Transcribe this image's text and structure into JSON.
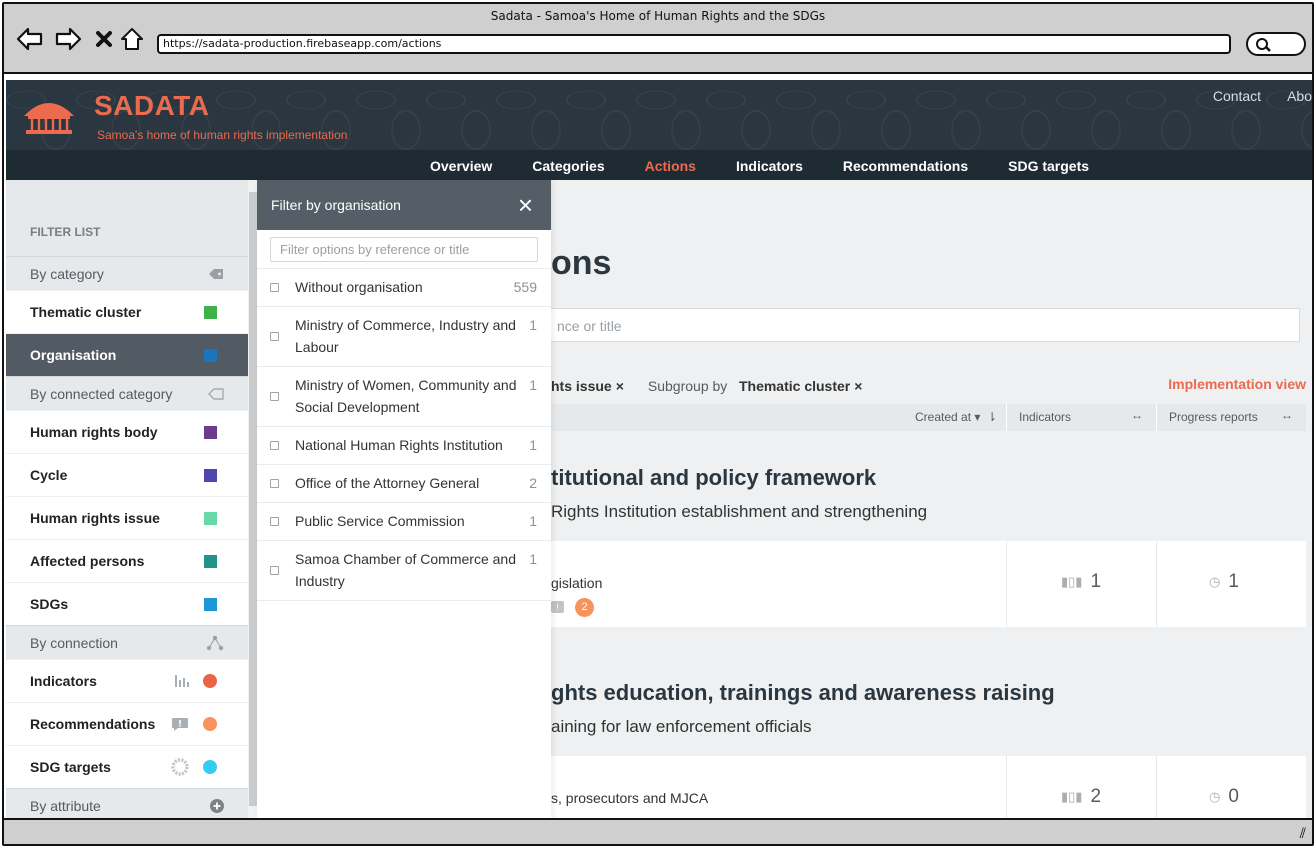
{
  "window": {
    "title": "Sadata - Samoa's Home of Human Rights and the SDGs",
    "url": "https://sadata-production.firebaseapp.com/actions"
  },
  "header": {
    "brand": "SADATA",
    "tagline": "Samoa's home of human rights implementation",
    "top_links": [
      "Contact",
      "Abo"
    ],
    "nav": [
      {
        "label": "Overview",
        "active": false
      },
      {
        "label": "Categories",
        "active": false
      },
      {
        "label": "Actions",
        "active": true
      },
      {
        "label": "Indicators",
        "active": false
      },
      {
        "label": "Recommendations",
        "active": false
      },
      {
        "label": "SDG targets",
        "active": false
      }
    ]
  },
  "sidebar": {
    "heading": "FILTER LIST",
    "group_category": "By category",
    "group_connected": "By connected category",
    "group_connection": "By connection",
    "group_attribute": "By attribute",
    "category_items": [
      {
        "label": "Thematic cluster",
        "color": "#3db249"
      },
      {
        "label": "Organisation",
        "color": "#1b75bb",
        "active": true
      }
    ],
    "connected_items": [
      {
        "label": "Human rights body",
        "color": "#6d3b8e"
      },
      {
        "label": "Cycle",
        "color": "#4f46b0"
      },
      {
        "label": "Human rights issue",
        "color": "#67d9a8"
      },
      {
        "label": "Affected persons",
        "color": "#21938a"
      },
      {
        "label": "SDGs",
        "color": "#1e97d6"
      }
    ],
    "connection_items": [
      {
        "label": "Indicators",
        "color": "#ea6447",
        "icon": "indicator-bars-icon"
      },
      {
        "label": "Recommendations",
        "color": "#f7935c",
        "icon": "comment-icon"
      },
      {
        "label": "SDG targets",
        "color": "#33ccf2",
        "icon": "sdg-wheel-icon"
      }
    ]
  },
  "filter_panel": {
    "title": "Filter by organisation",
    "close_icon": "×",
    "search_placeholder": "Filter options by reference or title",
    "options": [
      {
        "label": "Without organisation",
        "count": "559"
      },
      {
        "label": "Ministry of Commerce, Industry and Labour",
        "count": "1"
      },
      {
        "label": "Ministry of Women, Community and Social Development",
        "count": "1"
      },
      {
        "label": "National Human Rights Institution",
        "count": "1"
      },
      {
        "label": "Office of the Attorney General",
        "count": "2"
      },
      {
        "label": "Public Service Commission",
        "count": "1"
      },
      {
        "label": "Samoa Chamber of Commerce and Industry",
        "count": "1"
      }
    ]
  },
  "main": {
    "title_fragment": "ons",
    "search_fragment": "nce or title",
    "group_chip": "hts issue",
    "subgroup_label": "Subgroup by",
    "subgroup_value": "Thematic cluster",
    "implementation_link": "Implementation view",
    "columns": {
      "created": "Created at",
      "indicators": "Indicators",
      "progress": "Progress reports"
    },
    "groups": [
      {
        "title": "titutional and policy framework",
        "subtitle": "Rights Institution establishment and strengthening",
        "card": {
          "title": "gislation",
          "indicators": "1",
          "progress": "1",
          "badge": "2"
        }
      },
      {
        "title": "ghts education, trainings and awareness raising",
        "subtitle": "aining for law enforcement officials",
        "card": {
          "title": "s, prosecutors and MJCA",
          "indicators": "2",
          "progress": "0"
        }
      }
    ]
  }
}
